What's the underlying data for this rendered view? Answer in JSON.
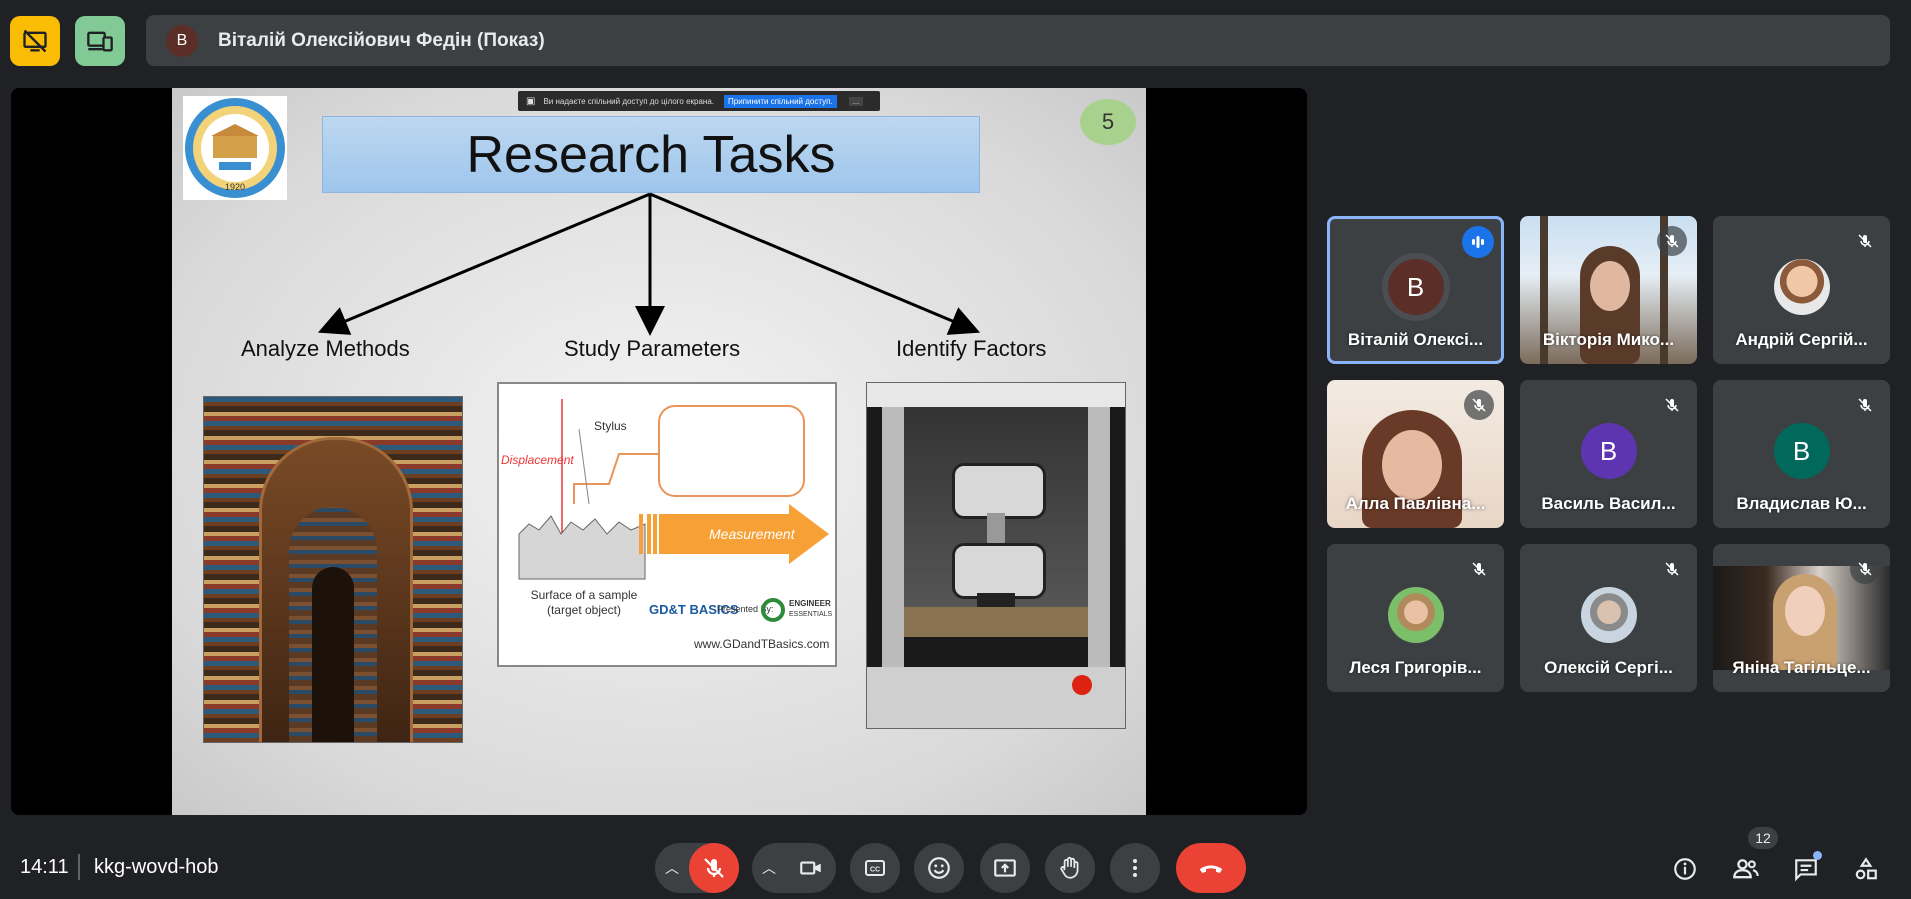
{
  "presenter": {
    "avatar_letter": "В",
    "title": "Віталій Олексійович Федін (Показ)"
  },
  "share_banner": {
    "text": "Ви надаєте спільний доступ до цілого екрана.",
    "stop_label": "Припинити спільний доступ.",
    "minimize_label": "..."
  },
  "slide": {
    "title": "Research Tasks",
    "page_number": "5",
    "tasks": [
      "Analyze Methods",
      "Study Parameters",
      "Identify Factors"
    ],
    "diagram": {
      "stylus": "Stylus",
      "displacement": "Displacement",
      "measurement": "Measurement",
      "surface_line1": "Surface of a sample",
      "surface_line2": "(target object)",
      "brand": "GD&T BASICS",
      "presented_by": "Presented By:",
      "engineer": "ENGINEER",
      "essentials": "ESSENTIALS",
      "url": "www.GDandTBasics.com"
    },
    "logo_year": "1920"
  },
  "participants": [
    {
      "name": "Віталій Олексі...",
      "avatar": "В",
      "avatar_color": "#5b2f27",
      "speaking": true,
      "has_video": false
    },
    {
      "name": "Вікторія Мико...",
      "avatar": "",
      "muted": true,
      "has_video": true
    },
    {
      "name": "Андрій Сергій...",
      "avatar": "",
      "muted": true,
      "has_video": false,
      "photo_avatar": true
    },
    {
      "name": "Алла Павлівна...",
      "avatar": "",
      "muted": true,
      "has_video": true
    },
    {
      "name": "Василь Васил...",
      "avatar": "В",
      "avatar_color": "#5e35b1",
      "muted": true,
      "has_video": false
    },
    {
      "name": "Владислав Ю...",
      "avatar": "В",
      "avatar_color": "#00695c",
      "muted": true,
      "has_video": false
    },
    {
      "name": "Леся Григорів...",
      "avatar": "",
      "muted": true,
      "has_video": false,
      "photo_avatar": true
    },
    {
      "name": "Олексій Сергі...",
      "avatar": "",
      "muted": true,
      "has_video": false,
      "photo_avatar": true
    },
    {
      "name": "Яніна Тагільце...",
      "avatar": "",
      "muted": true,
      "has_video": true
    }
  ],
  "bottom_bar": {
    "time": "14:11",
    "meeting_code": "kkg-wovd-hob",
    "participants_count": "12"
  },
  "colors": {
    "end_call": "#ea4335",
    "accent_blue": "#1a73e8",
    "top_yellow": "#fbbc04",
    "top_green": "#81c995"
  }
}
